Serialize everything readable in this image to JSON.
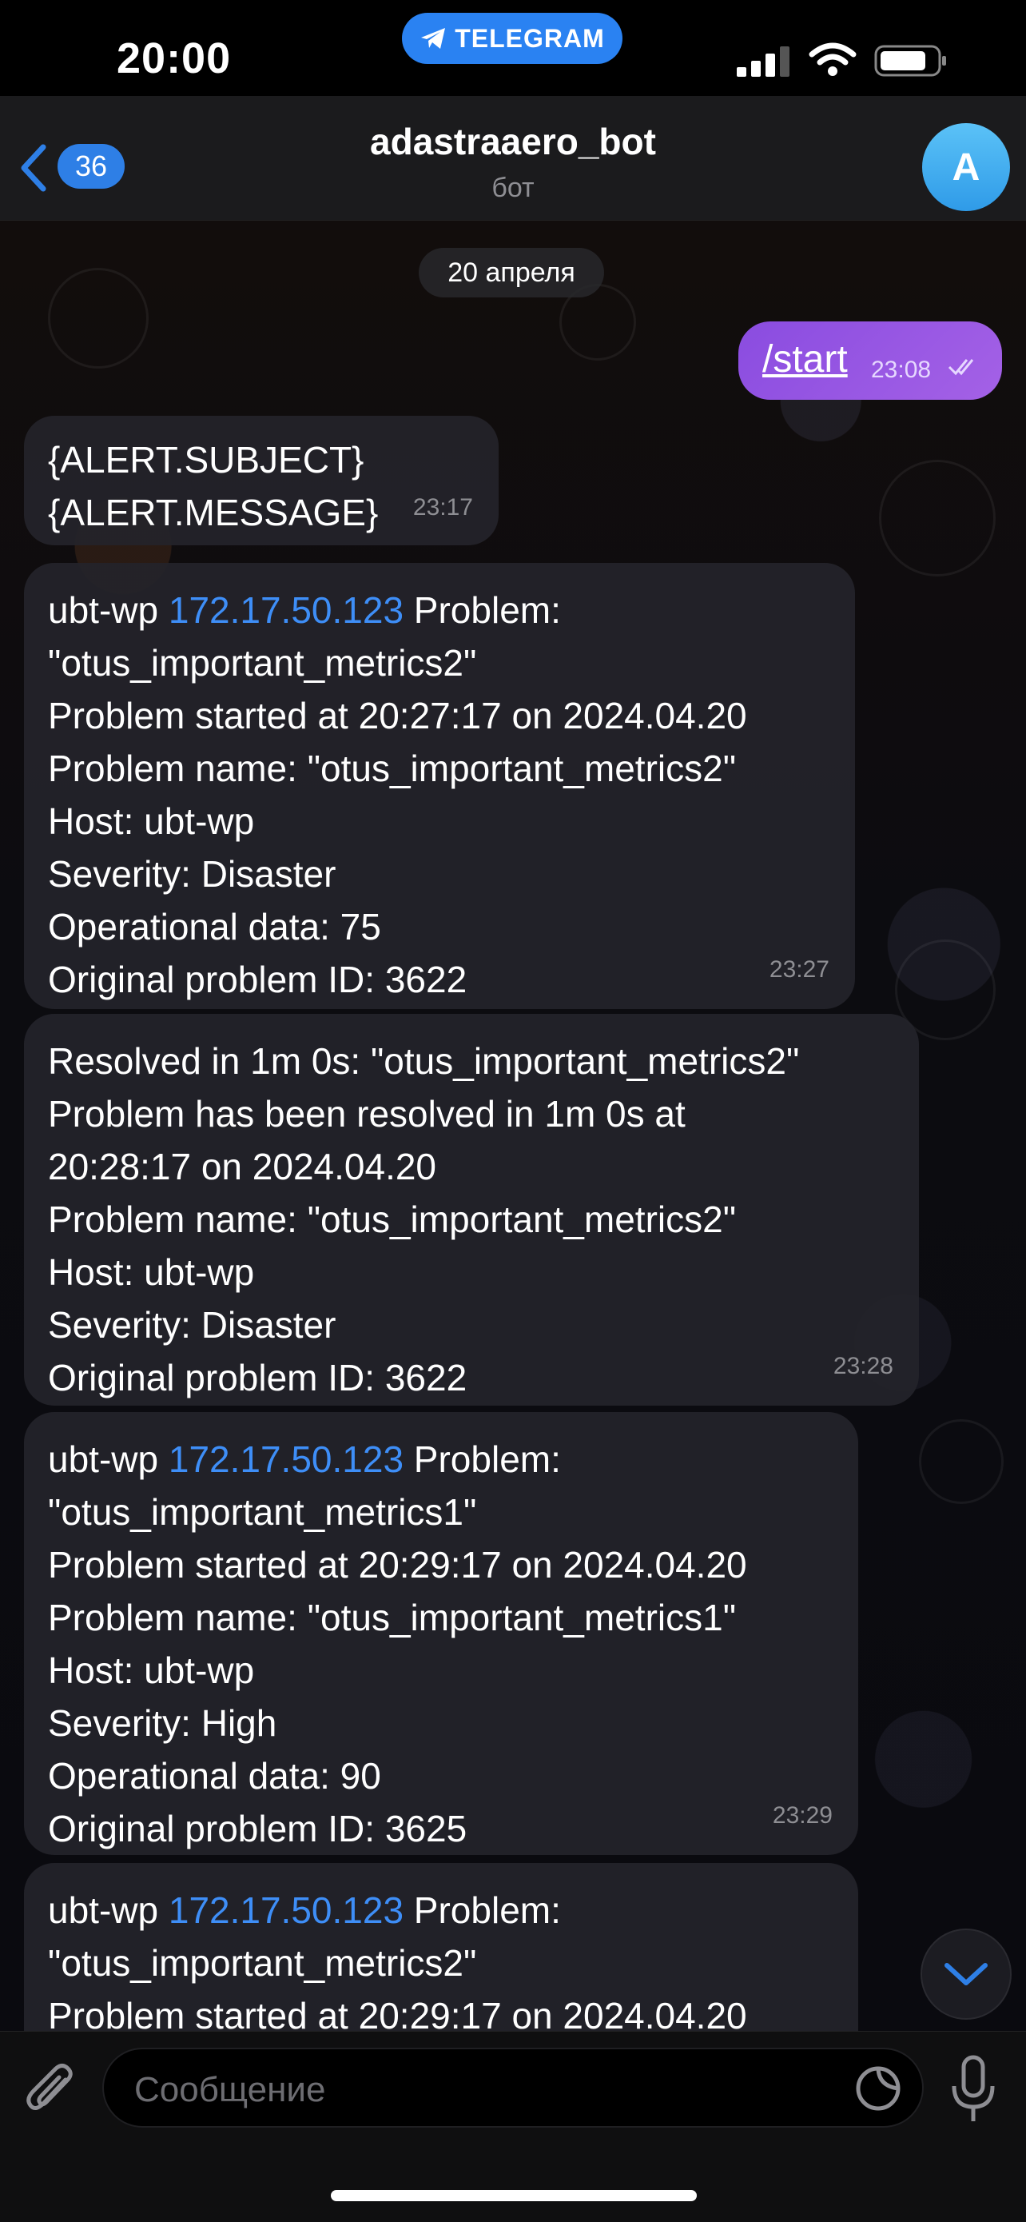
{
  "status_bar": {
    "time": "20:00",
    "app_pill": "TELEGRAM"
  },
  "header": {
    "unread_count": "36",
    "title": "adastraaero_bot",
    "subtitle": "бот",
    "avatar_letter": "A"
  },
  "date_separator": "20 апреля",
  "outgoing": {
    "text": "/start",
    "time": "23:08"
  },
  "messages": [
    {
      "lines": [
        "{ALERT.SUBJECT}",
        "{ALERT.MESSAGE}"
      ],
      "time": "23:17"
    },
    {
      "prefix": "ubt-wp ",
      "ip": "172.17.50.123",
      "suffix": " Problem:",
      "lines": [
        "\"otus_important_metrics2\"",
        "Problem started at 20:27:17 on 2024.04.20",
        "Problem name: \"otus_important_metrics2\"",
        "Host: ubt-wp",
        "Severity: Disaster",
        "Operational data: 75",
        "Original problem ID: 3622"
      ],
      "time": "23:27"
    },
    {
      "lines": [
        "Resolved in 1m 0s: \"otus_important_metrics2\"",
        "Problem has been resolved in 1m 0s at",
        "20:28:17 on 2024.04.20",
        "Problem name: \"otus_important_metrics2\"",
        "Host: ubt-wp",
        "Severity: Disaster",
        "Original problem ID: 3622"
      ],
      "time": "23:28"
    },
    {
      "prefix": "ubt-wp ",
      "ip": "172.17.50.123",
      "suffix": " Problem:",
      "lines": [
        "\"otus_important_metrics1\"",
        "Problem started at 20:29:17 on 2024.04.20",
        "Problem name: \"otus_important_metrics1\"",
        "Host: ubt-wp",
        "Severity: High",
        "Operational data: 90",
        "Original problem ID: 3625"
      ],
      "time": "23:29"
    },
    {
      "prefix": "ubt-wp ",
      "ip": "172.17.50.123",
      "suffix": " Problem:",
      "lines": [
        "\"otus_important_metrics2\"",
        "Problem started at 20:29:17 on 2024.04.20"
      ]
    }
  ],
  "input": {
    "placeholder": "Сообщение"
  },
  "colors": {
    "accent": "#2a82f2",
    "link": "#3e8ef7",
    "outgoing": "#9b59e4"
  }
}
